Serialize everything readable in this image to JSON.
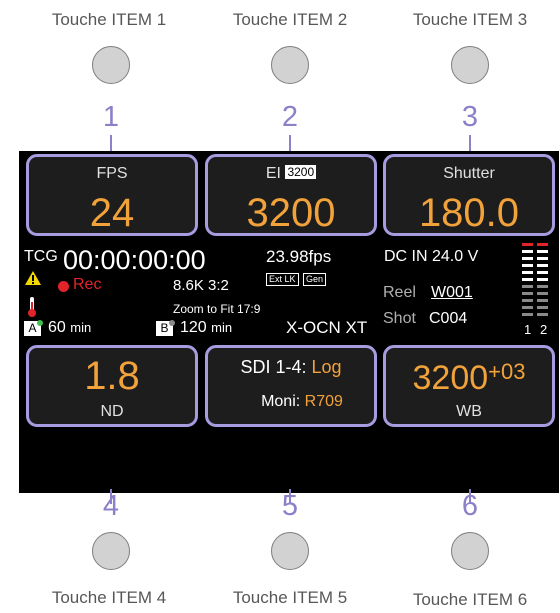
{
  "captions": {
    "top": [
      "Touche ITEM 1",
      "Touche ITEM 2",
      "Touche ITEM 3"
    ],
    "bottom": [
      "Touche ITEM 4",
      "Touche ITEM 5",
      "Touche ITEM 6"
    ]
  },
  "numbers": [
    "1",
    "2",
    "3",
    "4",
    "5",
    "6"
  ],
  "tiles": {
    "fps": {
      "label": "FPS",
      "value": "24"
    },
    "ei": {
      "label": "EI",
      "badge": "3200",
      "value": "3200"
    },
    "shutter": {
      "label": "Shutter",
      "value": "180.0"
    },
    "nd": {
      "value": "1.8",
      "label": "ND"
    },
    "sdi": {
      "line1_label": "SDI 1-4:",
      "line1_value": "Log",
      "line2_label": "Moni:",
      "line2_value": "R709"
    },
    "wb": {
      "value": "3200",
      "offset": "+03",
      "label": "WB"
    }
  },
  "status": {
    "tcg_label": "TCG",
    "timecode": "00:00:00:00",
    "fps_readout": "23.98fps",
    "ext_lk": "Ext LK",
    "gen": "Gen",
    "dc_in": "DC IN 24.0 V",
    "rec_label": "Rec",
    "resolution": "8.6K 3:2",
    "reel_label": "Reel",
    "reel_value": "W001",
    "shot_label": "Shot",
    "shot_value": "C004",
    "zoom": "Zoom to Fit 17:9",
    "slot_a_label": "A",
    "slot_a_time": "60",
    "slot_b_label": "B",
    "slot_b_time": "120",
    "min_unit": "min",
    "codec": "X-OCN XT",
    "meter_ch1": "1",
    "meter_ch2": "2"
  },
  "colors": {
    "accent_orange": "#f2a23b",
    "tile_border": "#a69ce0",
    "rec_red": "#e0242a",
    "warning_yellow": "#f5d800",
    "slot_green": "#3fc24d"
  }
}
